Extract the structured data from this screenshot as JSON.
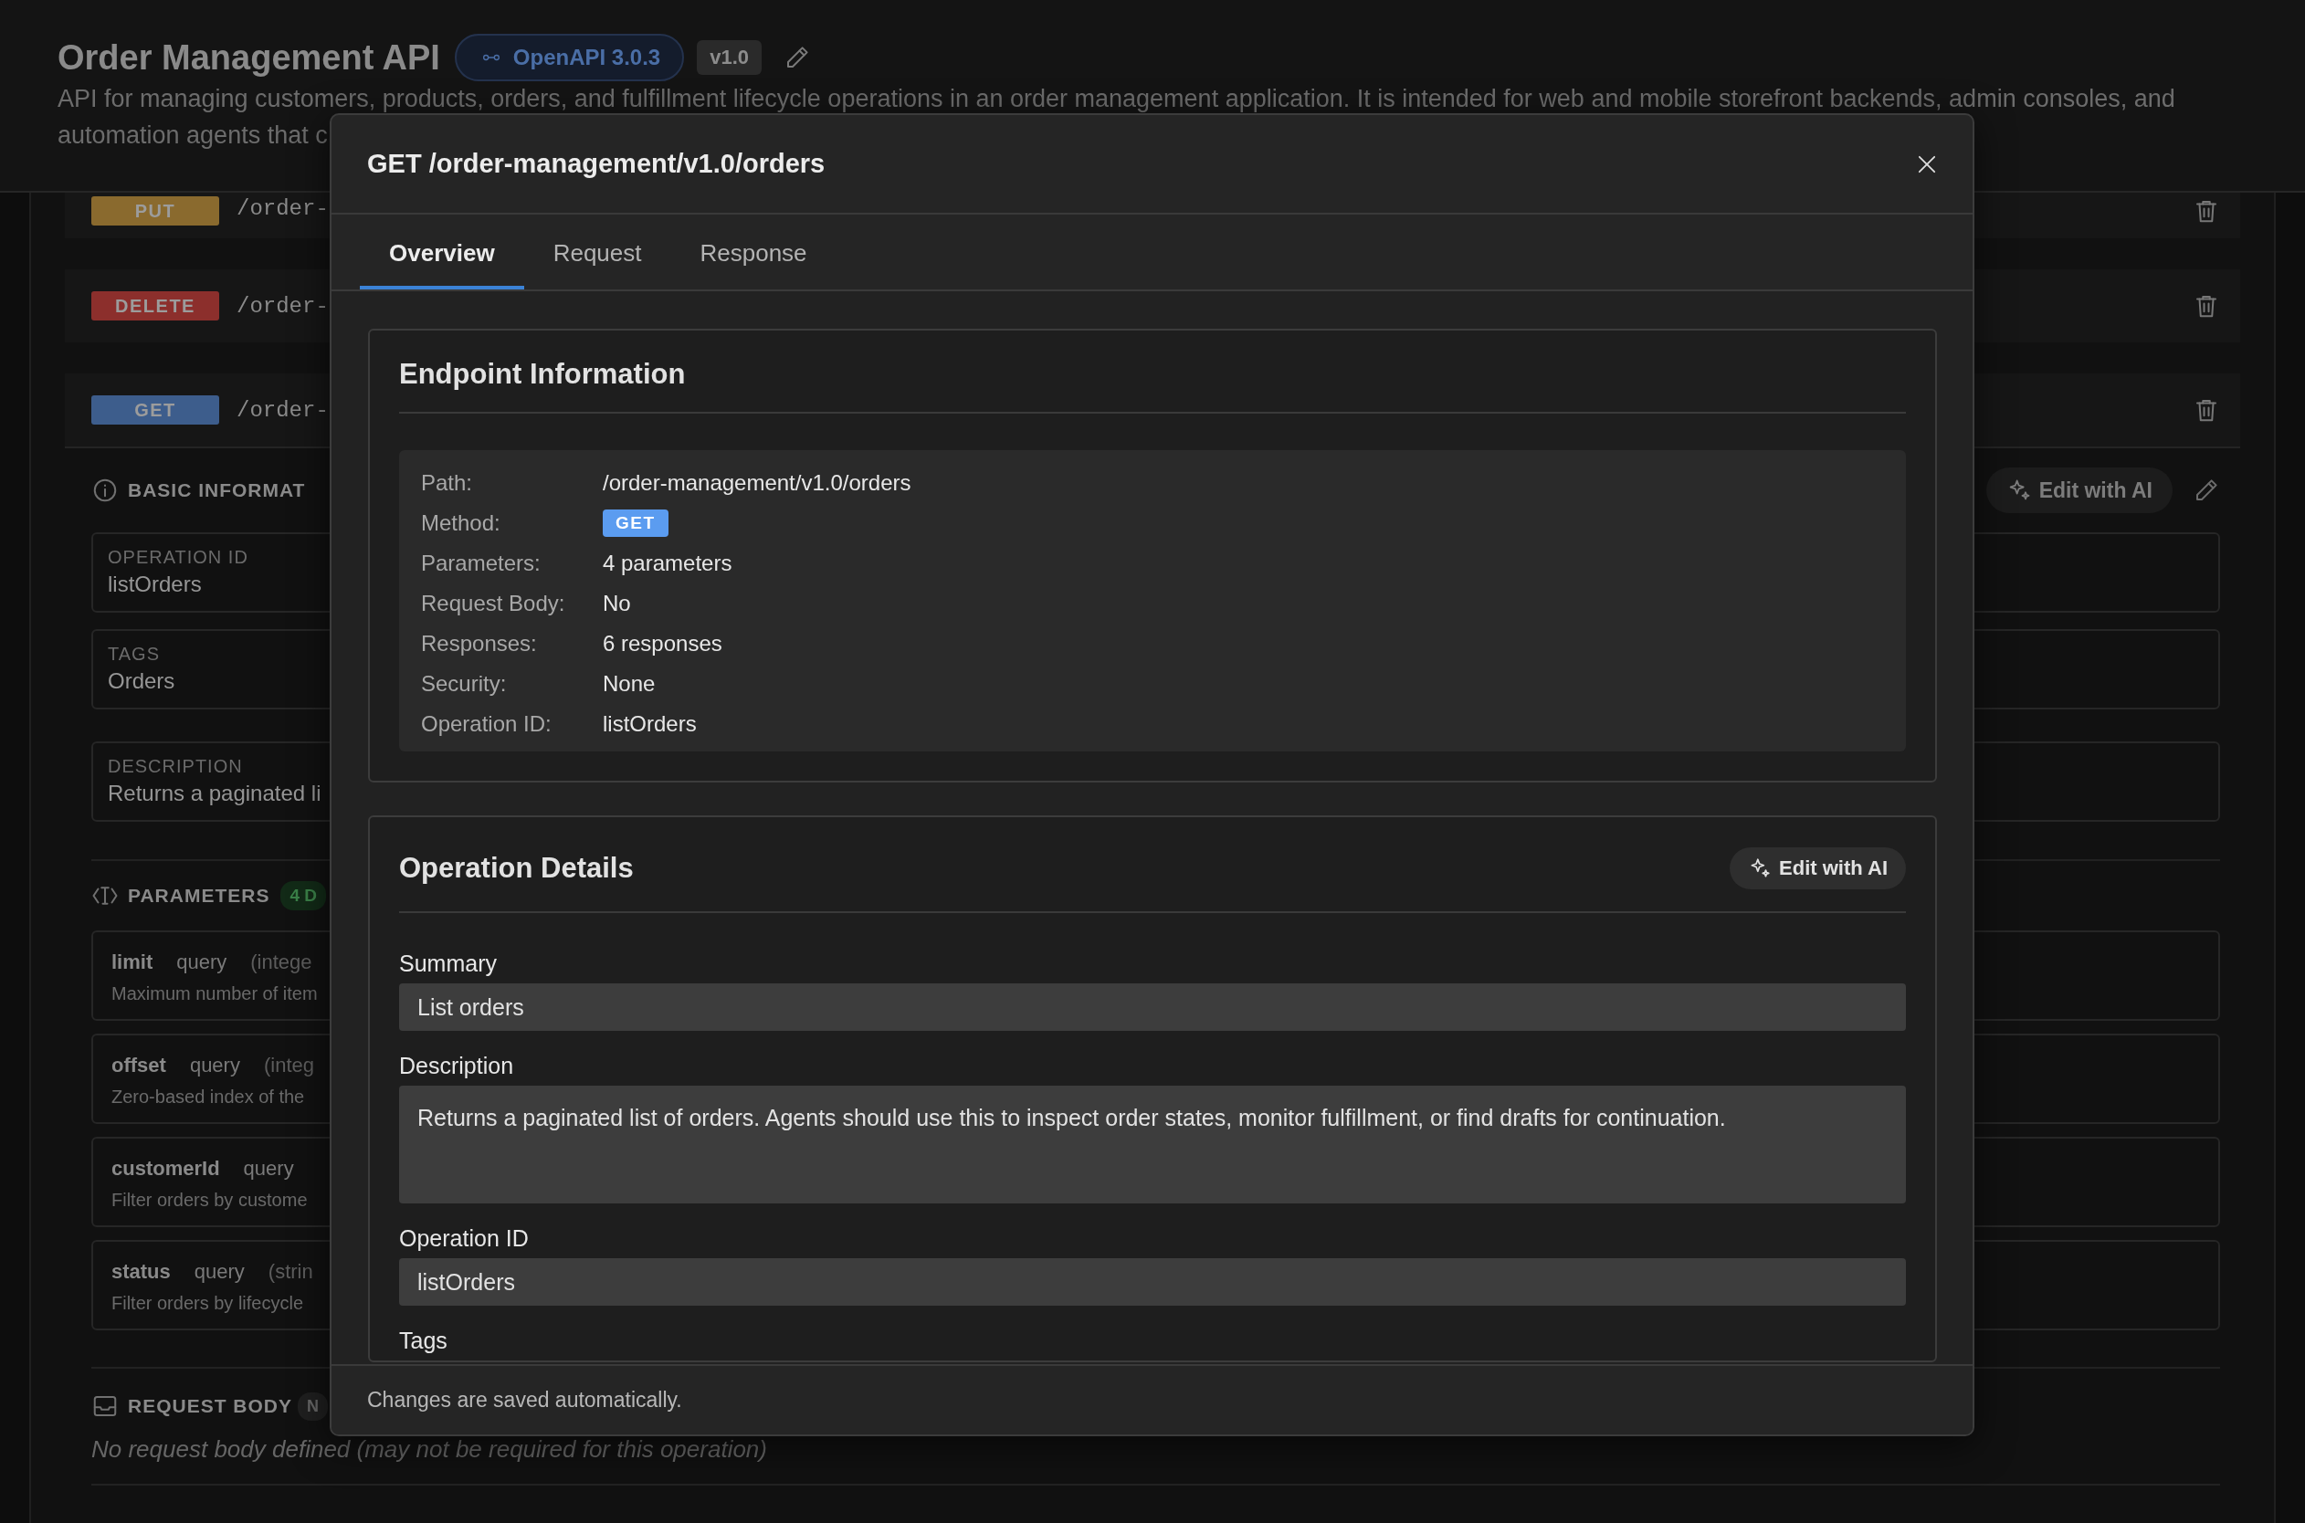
{
  "header": {
    "title": "Order Management API",
    "spec_badge": "OpenAPI 3.0.3",
    "version": "v1.0",
    "description_lines": [
      "API for managing customers, products, orders, and fulfillment lifecycle operations in an order management application. It is intended for web and mobile storefront backends, admin consoles, and",
      "automation agents that c"
    ]
  },
  "endpoints": [
    {
      "method": "PUT",
      "path": "/order-",
      "color": "#8a6a2e",
      "expanded": false
    },
    {
      "method": "DELETE",
      "path": "/order-",
      "color": "#8c2f2c",
      "expanded": false
    },
    {
      "method": "GET",
      "path": "/order-",
      "color": "#3d5d8c",
      "expanded": true
    }
  ],
  "basic_info": {
    "title": "BASIC INFORMAT",
    "edit_button": "Edit with AI",
    "fields": [
      {
        "label": "OPERATION ID",
        "value": "listOrders"
      },
      {
        "label": "TAGS",
        "value": "Orders"
      },
      {
        "label": "DESCRIPTION",
        "value": "Returns a paginated li"
      }
    ]
  },
  "parameters": {
    "title": "PARAMETERS",
    "badge": "4 D",
    "items": [
      {
        "name": "limit",
        "location": "query",
        "type": "(intege",
        "description": "Maximum number of item"
      },
      {
        "name": "offset",
        "location": "query",
        "type": "(integ",
        "description": "Zero-based index of the"
      },
      {
        "name": "customerId",
        "location": "query",
        "description": "Filter orders by custome"
      },
      {
        "name": "status",
        "location": "query",
        "type": "(strin",
        "description": "Filter orders by lifecycle"
      }
    ]
  },
  "request_body": {
    "title": "REQUEST BODY",
    "badge": "N",
    "empty_text": "No request body defined (may not be required for this operation)"
  },
  "modal": {
    "title": "GET /order-management/v1.0/orders",
    "tabs": [
      {
        "label": "Overview",
        "selected": true
      },
      {
        "label": "Request",
        "selected": false
      },
      {
        "label": "Response",
        "selected": false
      }
    ],
    "endpoint_info": {
      "title": "Endpoint Information",
      "rows": [
        {
          "label": "Path:",
          "value": "/order-management/v1.0/orders",
          "kind": "text"
        },
        {
          "label": "Method:",
          "value": "GET",
          "kind": "method"
        },
        {
          "label": "Parameters:",
          "value": "4 parameters",
          "kind": "text"
        },
        {
          "label": "Request Body:",
          "value": "No",
          "kind": "text"
        },
        {
          "label": "Responses:",
          "value": "6 responses",
          "kind": "text"
        },
        {
          "label": "Security:",
          "value": "None",
          "kind": "text"
        },
        {
          "label": "Operation ID:",
          "value": "listOrders",
          "kind": "text"
        }
      ]
    },
    "operation_details": {
      "title": "Operation Details",
      "edit_button": "Edit with AI",
      "fields": [
        {
          "label": "Summary",
          "value": "List orders",
          "kind": "input"
        },
        {
          "label": "Description",
          "value": "Returns a paginated list of orders. Agents should use this to inspect order states, monitor fulfillment, or find drafts for continuation.",
          "kind": "textarea"
        },
        {
          "label": "Operation ID",
          "value": "listOrders",
          "kind": "input"
        },
        {
          "label": "Tags",
          "kind": "label"
        }
      ]
    },
    "footer": "Changes are saved automatically."
  }
}
